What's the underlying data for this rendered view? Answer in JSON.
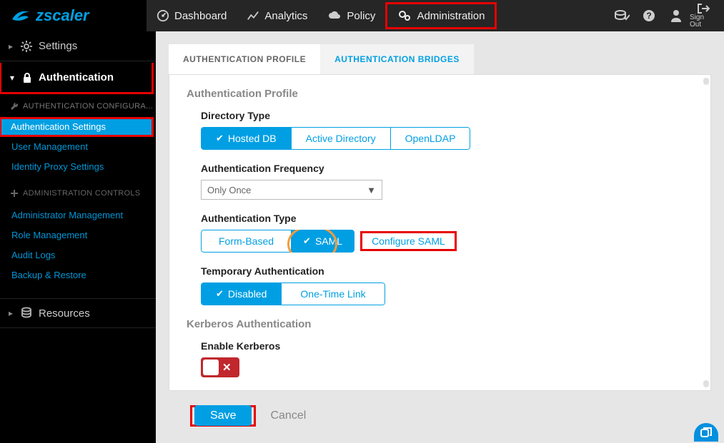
{
  "brand": "zscaler",
  "nav": {
    "dashboard": "Dashboard",
    "analytics": "Analytics",
    "policy": "Policy",
    "administration": "Administration"
  },
  "top_right": {
    "signout": "Sign Out"
  },
  "sidebar": {
    "settings": "Settings",
    "authentication": "Authentication",
    "auth_config_head": "AUTHENTICATION CONFIGURA...",
    "items": [
      "Authentication Settings",
      "User Management",
      "Identity Proxy Settings"
    ],
    "admin_controls_head": "ADMINISTRATION CONTROLS",
    "admin_items": [
      "Administrator Management",
      "Role Management",
      "Audit Logs",
      "Backup & Restore"
    ],
    "resources": "Resources"
  },
  "tabs": {
    "profile": "AUTHENTICATION PROFILE",
    "bridges": "AUTHENTICATION BRIDGES"
  },
  "panel": {
    "title": "Authentication Profile",
    "dir_type_label": "Directory Type",
    "dir_options": {
      "hosted": "Hosted DB",
      "ad": "Active Directory",
      "ldap": "OpenLDAP"
    },
    "freq_label": "Authentication Frequency",
    "freq_value": "Only Once",
    "authtype_label": "Authentication Type",
    "authtype_options": {
      "form": "Form-Based",
      "saml": "SAML"
    },
    "config_saml": "Configure SAML",
    "temp_auth_label": "Temporary Authentication",
    "temp_options": {
      "disabled": "Disabled",
      "otl": "One-Time Link"
    },
    "kerb_title": "Kerberos Authentication",
    "kerb_label": "Enable Kerberos"
  },
  "footer": {
    "save": "Save",
    "cancel": "Cancel"
  }
}
